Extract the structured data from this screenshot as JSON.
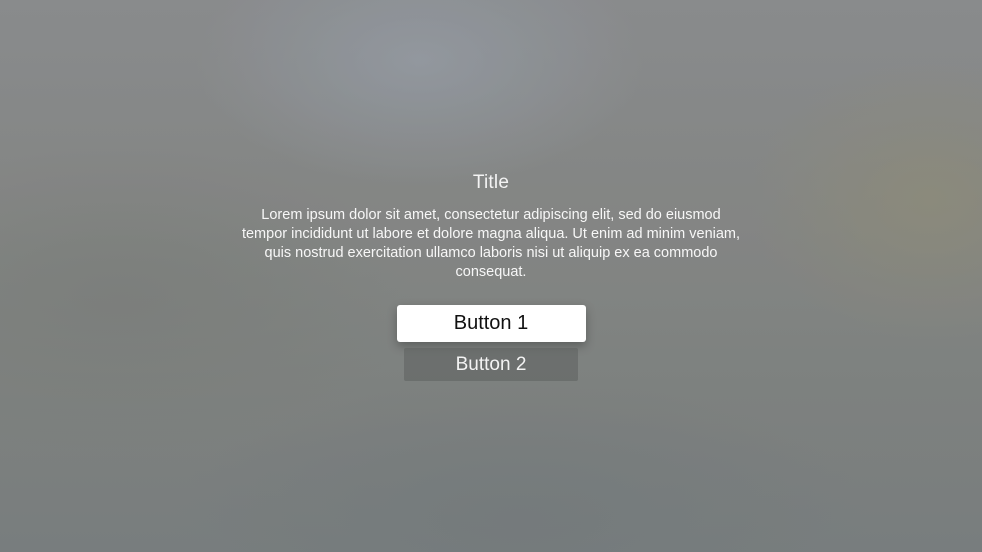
{
  "alert": {
    "title": "Title",
    "message": "Lorem ipsum dolor sit amet, consectetur adipiscing elit, sed do eiusmod tempor incididunt ut labore et dolore magna aliqua. Ut enim ad minim veniam, quis nostrud exercitation ullamco laboris nisi ut aliquip ex ea commodo consequat.",
    "buttons": [
      {
        "label": "Button 1",
        "focused": true
      },
      {
        "label": "Button 2",
        "focused": false
      }
    ]
  },
  "colors": {
    "focused_button_bg": "#ffffff",
    "focused_button_text": "#111111",
    "unfocused_button_text": "#f3f3f3",
    "text": "#f7f7f7"
  }
}
